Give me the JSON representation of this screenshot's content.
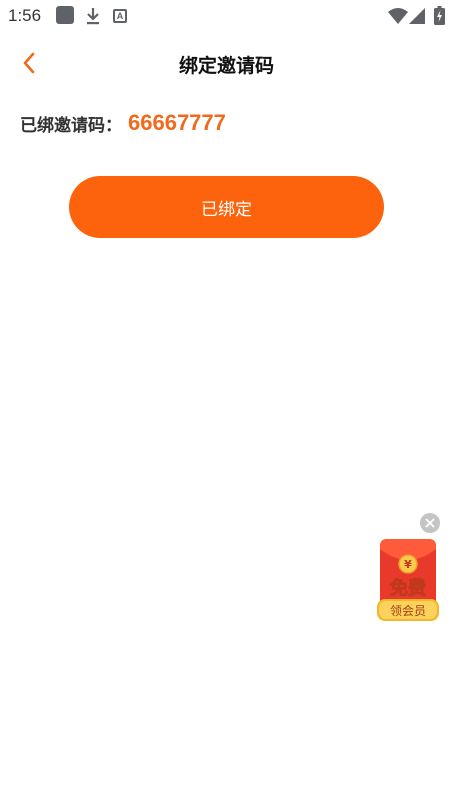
{
  "status_bar": {
    "time": "1:56",
    "icons": [
      "notification-square-icon",
      "download-icon",
      "a-badge-icon",
      "wifi-icon",
      "signal-icon",
      "battery-icon"
    ]
  },
  "nav": {
    "title": "绑定邀请码",
    "back_icon": "chevron-left-icon"
  },
  "invite": {
    "label": "已绑邀请码：",
    "code": "66667777"
  },
  "bind_button": {
    "label": "已绑定"
  },
  "floating_ad": {
    "close_icon": "close-icon",
    "yen_symbol": "¥",
    "main_text": "免费",
    "sub_text": "领会员"
  },
  "colors": {
    "accent": "#fd620d",
    "code_color": "#f06a1e",
    "ad_red": "#e8392a",
    "ad_gold": "#f6b52e"
  }
}
